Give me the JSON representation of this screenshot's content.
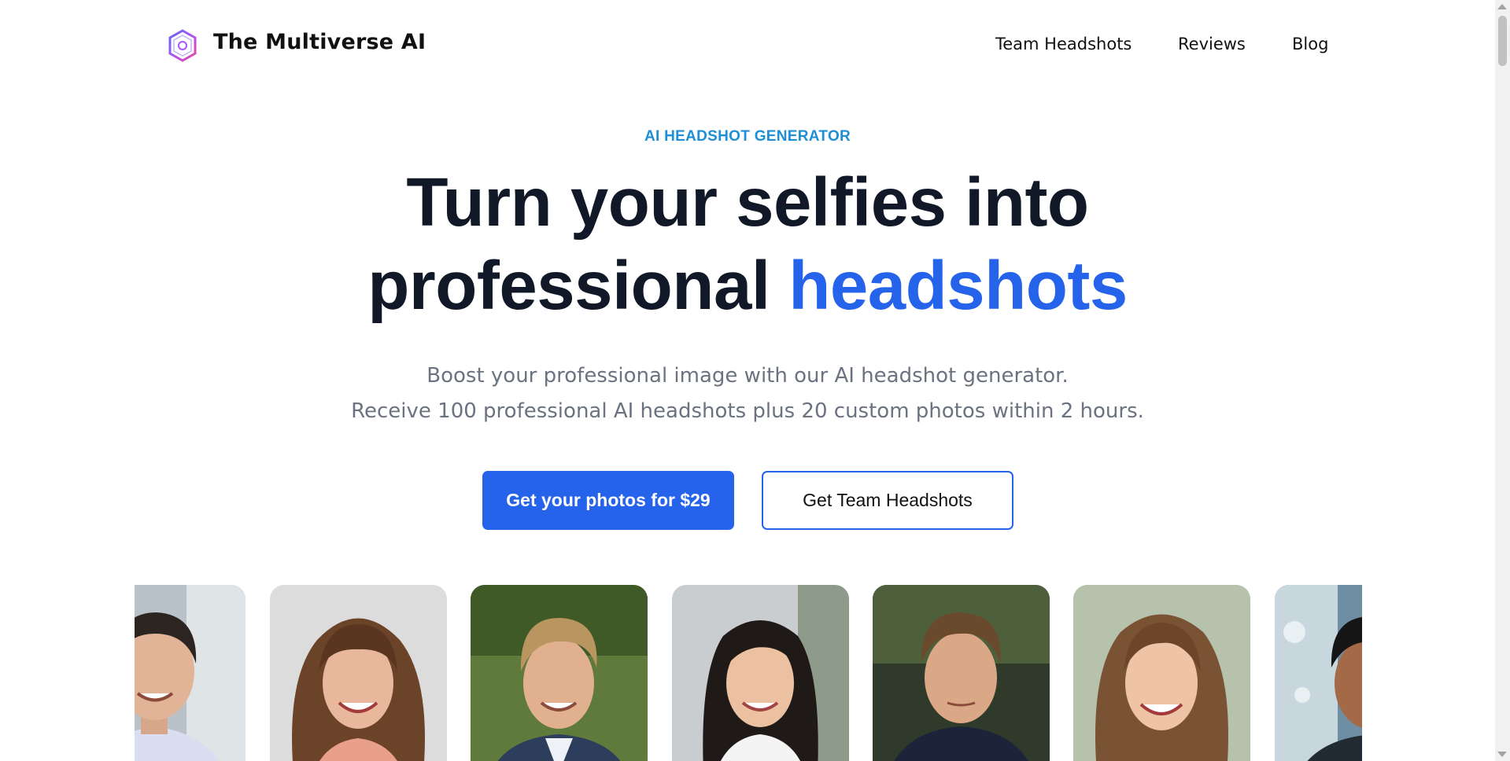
{
  "header": {
    "brand": "The Multiverse AI",
    "logo_icon": "multiverse-logo-icon",
    "nav": [
      {
        "label": "Team Headshots"
      },
      {
        "label": "Reviews"
      },
      {
        "label": "Blog"
      }
    ]
  },
  "hero": {
    "eyebrow": "AI HEADSHOT GENERATOR",
    "headline_line1": "Turn your selfies into",
    "headline_line2_plain": "professional ",
    "headline_line2_accent": "headshots",
    "subtext_line1": "Boost your professional image with our AI headshot generator.",
    "subtext_line2": "Receive 100 professional AI headshots plus 20 custom photos within 2 hours.",
    "primary_button": "Get your photos for $29",
    "secondary_button": "Get Team Headshots"
  },
  "gallery": {
    "photos": [
      {
        "subject": "man with short dark hair smiling"
      },
      {
        "subject": "woman with brown wavy hair and bangs"
      },
      {
        "subject": "man with swept blond hair in suit"
      },
      {
        "subject": "woman with long dark hair in white shirt"
      },
      {
        "subject": "man with brown hair in navy polo"
      },
      {
        "subject": "woman with long brown hair smiling"
      },
      {
        "subject": "man with dark curly hair"
      }
    ]
  },
  "colors": {
    "accent": "#2563eb",
    "eyebrow": "#1d8fd6",
    "heading": "#111827",
    "muted_text": "#6b7280"
  }
}
